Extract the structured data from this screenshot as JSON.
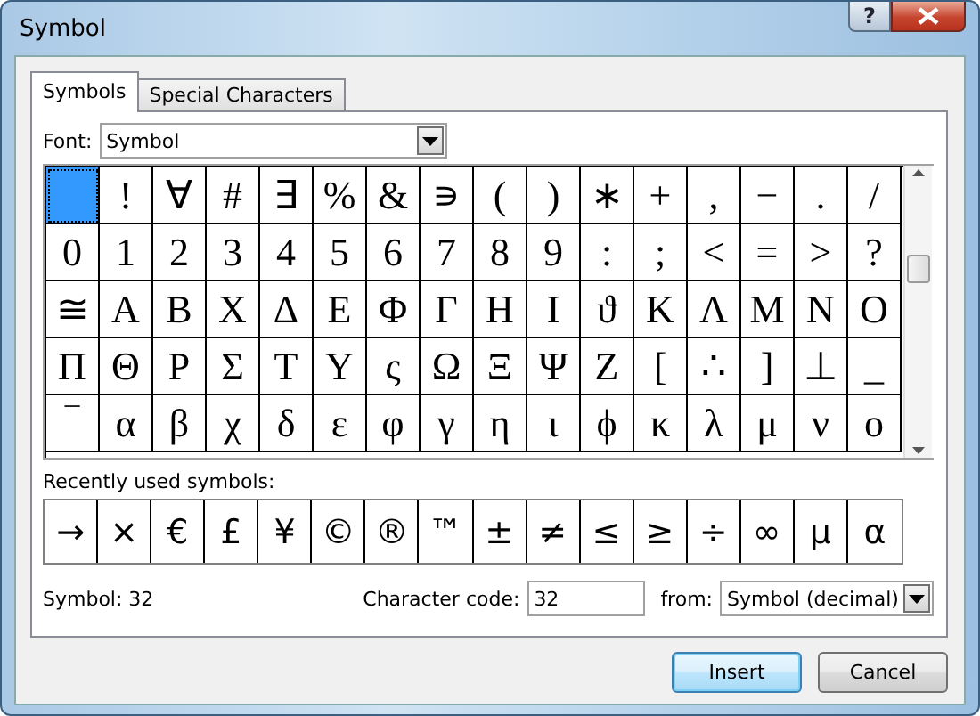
{
  "window": {
    "title": "Symbol",
    "help_button": "?"
  },
  "tabs": [
    {
      "label": "Symbols",
      "selected": true
    },
    {
      "label": "Special Characters",
      "selected": false
    }
  ],
  "font": {
    "label": "Font:",
    "value": "Symbol"
  },
  "symbol_grid": [
    {
      "cells": [
        {
          "selected": true
        },
        {
          "char": "!",
          "selected": false
        },
        {
          "char": "∀",
          "selected": false
        },
        {
          "char": "#",
          "selected": false
        },
        {
          "char": "∃",
          "selected": false
        },
        {
          "char": "%",
          "selected": false
        },
        {
          "char": "&",
          "selected": false
        },
        {
          "char": "∍",
          "selected": false
        },
        {
          "char": "(",
          "selected": false
        },
        {
          "char": ")",
          "selected": false
        },
        {
          "char": "∗",
          "selected": false
        },
        {
          "char": "+",
          "selected": false
        },
        {
          "char": ",",
          "selected": false
        },
        {
          "char": "−",
          "selected": false
        },
        {
          "char": ".",
          "selected": false
        },
        {
          "char": "/",
          "selected": false
        }
      ]
    },
    {
      "cells": [
        {
          "char": "0",
          "selected": false
        },
        {
          "char": "1",
          "selected": false
        },
        {
          "char": "2",
          "selected": false
        },
        {
          "char": "3",
          "selected": false
        },
        {
          "char": "4",
          "selected": false
        },
        {
          "char": "5",
          "selected": false
        },
        {
          "char": "6",
          "selected": false
        },
        {
          "char": "7",
          "selected": false
        },
        {
          "char": "8",
          "selected": false
        },
        {
          "char": "9",
          "selected": false
        },
        {
          "char": ":",
          "selected": false
        },
        {
          "char": ";",
          "selected": false
        },
        {
          "char": "<",
          "selected": false
        },
        {
          "char": "=",
          "selected": false
        },
        {
          "char": ">",
          "selected": false
        },
        {
          "char": "?",
          "selected": false
        }
      ]
    },
    {
      "cells": [
        {
          "char": "≅",
          "selected": false
        },
        {
          "char": "Α",
          "selected": false
        },
        {
          "char": "Β",
          "selected": false
        },
        {
          "char": "Χ",
          "selected": false
        },
        {
          "char": "Δ",
          "selected": false
        },
        {
          "char": "Ε",
          "selected": false
        },
        {
          "char": "Φ",
          "selected": false
        },
        {
          "char": "Γ",
          "selected": false
        },
        {
          "char": "Η",
          "selected": false
        },
        {
          "char": "Ι",
          "selected": false
        },
        {
          "char": "ϑ",
          "selected": false
        },
        {
          "char": "Κ",
          "selected": false
        },
        {
          "char": "Λ",
          "selected": false
        },
        {
          "char": "Μ",
          "selected": false
        },
        {
          "char": "Ν",
          "selected": false
        },
        {
          "char": "Ο",
          "selected": false
        }
      ]
    },
    {
      "cells": [
        {
          "char": "Π",
          "selected": false
        },
        {
          "char": "Θ",
          "selected": false
        },
        {
          "char": "Ρ",
          "selected": false
        },
        {
          "char": "Σ",
          "selected": false
        },
        {
          "char": "Τ",
          "selected": false
        },
        {
          "char": "Υ",
          "selected": false
        },
        {
          "char": "ς",
          "selected": false
        },
        {
          "char": "Ω",
          "selected": false
        },
        {
          "char": "Ξ",
          "selected": false
        },
        {
          "char": "Ψ",
          "selected": false
        },
        {
          "char": "Ζ",
          "selected": false
        },
        {
          "char": "[",
          "selected": false
        },
        {
          "char": "∴",
          "selected": false
        },
        {
          "char": "]",
          "selected": false
        },
        {
          "char": "⊥",
          "selected": false
        },
        {
          "char": "_",
          "selected": false
        }
      ]
    },
    {
      "cells": [
        {
          "char": "‾",
          "selected": false
        },
        {
          "char": "α",
          "selected": false
        },
        {
          "char": "β",
          "selected": false
        },
        {
          "char": "χ",
          "selected": false
        },
        {
          "char": "δ",
          "selected": false
        },
        {
          "char": "ε",
          "selected": false
        },
        {
          "char": "φ",
          "selected": false
        },
        {
          "char": "γ",
          "selected": false
        },
        {
          "char": "η",
          "selected": false
        },
        {
          "char": "ι",
          "selected": false
        },
        {
          "char": "ϕ",
          "selected": false
        },
        {
          "char": "κ",
          "selected": false
        },
        {
          "char": "λ",
          "selected": false
        },
        {
          "char": "μ",
          "selected": false
        },
        {
          "char": "ν",
          "selected": false
        },
        {
          "char": "ο",
          "selected": false
        }
      ]
    }
  ],
  "recently_used": {
    "label": "Recently used symbols:",
    "symbols": [
      "→",
      "×",
      "€",
      "£",
      "¥",
      "©",
      "®",
      "™",
      "±",
      "≠",
      "≤",
      "≥",
      "÷",
      "∞",
      "μ",
      "α"
    ]
  },
  "symbol_info": "Symbol: 32",
  "character_code": {
    "label": "Character code:",
    "value": "32"
  },
  "from": {
    "label": "from:",
    "value": "Symbol (decimal)"
  },
  "buttons": [
    {
      "label": "Insert",
      "default": true
    },
    {
      "label": "Cancel",
      "default": false
    }
  ]
}
